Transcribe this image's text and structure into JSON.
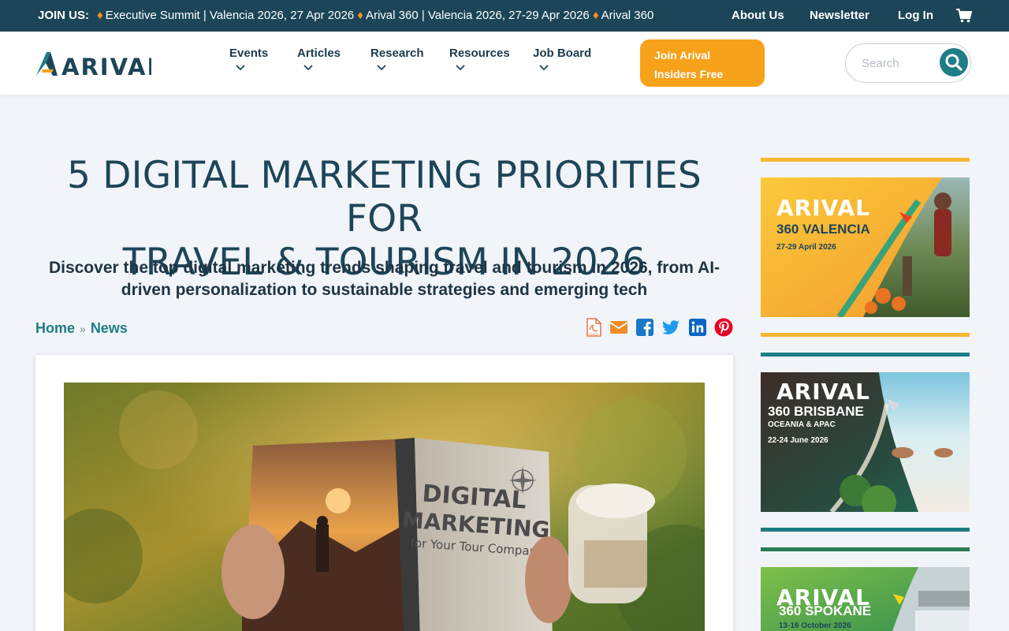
{
  "topbar": {
    "join_label": "JOIN US:",
    "ticker": [
      "Executive Summit | Valencia 2026, 27 Apr 2026",
      "Arival 360 | Valencia 2026, 27-29 Apr 2026",
      "Arival 360"
    ],
    "links": [
      "About Us",
      "Newsletter",
      "Log In"
    ],
    "cart_icon": "cart-icon"
  },
  "header": {
    "logo_text": "ARIVAL",
    "nav": [
      "Events",
      "Articles",
      "Research",
      "Resources",
      "Job Board"
    ],
    "cta_line1": "Join Arival",
    "cta_line2": "Insiders Free",
    "search_placeholder": "Search",
    "search_icon": "search-icon"
  },
  "article": {
    "title_line1": "5 DIGITAL MARKETING PRIORITIES FOR",
    "title_line2": "TRAVEL & TOURISM IN 2026",
    "subtitle_line1": "Discover the top digital marketing trends shaping travel and tourism in 2026, from AI-",
    "subtitle_line2": "driven personalization to sustainable strategies and emerging tech",
    "breadcrumb": [
      "Home",
      "News"
    ],
    "breadcrumb_sep": "»",
    "share_icons": [
      "pdf-icon",
      "email-icon",
      "facebook-icon",
      "twitter-icon",
      "linkedin-icon",
      "pinterest-icon"
    ],
    "hero_book": {
      "line1": "DIGITAL",
      "line2": "MARKETING",
      "line3": "for Your Tour Company"
    }
  },
  "sidebar": {
    "ads": [
      {
        "brand": "ARIVAL",
        "city": "360 VALENCIA",
        "date": "27-29 April 2026"
      },
      {
        "brand": "ARIVAL",
        "city": "360 BRISBANE",
        "sub": "OCEANIA & APAC",
        "date": "22-24 June 2026"
      },
      {
        "brand": "ARIVAL",
        "city": "360 SPOKANE",
        "date": "13-16 October 2026"
      }
    ]
  },
  "colors": {
    "topbar": "#1d4558",
    "accent_orange": "#f7a21b",
    "teal": "#1e7d86",
    "navy": "#1d4558"
  }
}
